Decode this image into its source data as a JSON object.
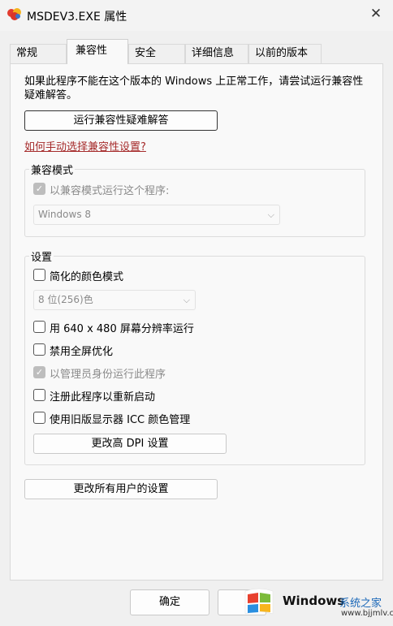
{
  "window": {
    "title": "MSDEV3.EXE 属性",
    "close_icon": "✕"
  },
  "tabs": [
    "常规",
    "兼容性",
    "安全",
    "详细信息",
    "以前的版本"
  ],
  "description": "如果此程序不能在这个版本的 Windows 上正常工作，请尝试运行兼容性疑难解答。",
  "troubleshoot_button": "运行兼容性疑难解答",
  "manual_link": "如何手动选择兼容性设置?",
  "compat_mode": {
    "group_title": "兼容模式",
    "checkbox_label": "以兼容模式运行这个程序:",
    "os_select": "Windows 8"
  },
  "settings": {
    "group_title": "设置",
    "reduced_color": "简化的颜色模式",
    "color_select": "8 位(256)色",
    "resolution_640": "用 640 x 480 屏幕分辨率运行",
    "disable_fullscreen": "禁用全屏优化",
    "run_as_admin": "以管理员身份运行此程序",
    "register_restart": "注册此程序以重新启动",
    "legacy_icc": "使用旧版显示器 ICC 颜色管理",
    "high_dpi_button": "更改高 DPI 设置"
  },
  "all_users_button": "更改所有用户的设置",
  "ok_button": "确定",
  "watermark": {
    "brand": "Windows",
    "site": "系统之家",
    "url": "www.bjjmlv.com"
  }
}
